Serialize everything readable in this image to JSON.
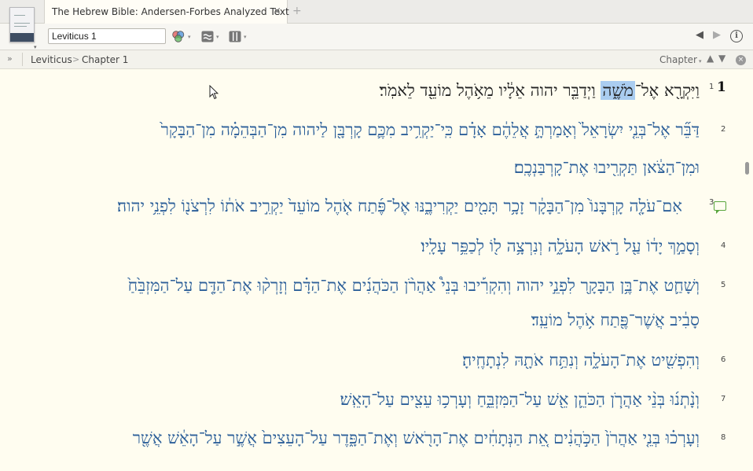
{
  "tab": {
    "title": "The Hebrew Bible: Andersen-Forbes Analyzed Text",
    "close_glyph": "×",
    "new_glyph": "+"
  },
  "thumbnail": {
    "caret": "▾"
  },
  "toolbar": {
    "reference_value": "Leviticus 1",
    "icons": [
      "visual-filters-icon",
      "parallel-resources-icon",
      "panel-layout-icon"
    ],
    "caret": "▾",
    "back_glyph": "◀",
    "forward_glyph": "▶",
    "info_glyph": "i"
  },
  "breadcrumb": {
    "expand_glyph": "»",
    "book": "Leviticus",
    "divider": ">",
    "chapter": "Chapter 1",
    "chapter_selector": "Chapter",
    "caret": "▾",
    "up_glyph": "▲",
    "down_glyph": "▼",
    "close_glyph": "×"
  },
  "colors": {
    "hebrew_text": "#2c5f99",
    "highlight": "#aacdf0",
    "note": "#59a63d",
    "background": "#fffdf0"
  },
  "text": {
    "chapter_number": "1",
    "verses": [
      {
        "num": "1",
        "parts": [
          "וַיִּקְרָ֖א אֶל־",
          "מֹשֶׁ֑ה",
          " וַיְדַבֵּ֤ר יהוה אֵלָ֔יו מֵאֹ֥הֶל מוֹעֵ֖ד לֵאמֹֽר׃"
        ]
      },
      {
        "num": "2",
        "lines": [
          "דַּבֵּ֞ר אֶל־בְּנֵ֤י יִשְׂרָאֵל֙ וְאָמַרְתָּ֣ אֲלֵהֶ֔ם אָדָ֗ם כִּֽי־יַקְרִ֥יב מִכֶּ֛ם קָרְבָּ֖ן לַיהוה מִן־הַבְּהֵמָ֗ה מִן־הַבָּקָר֙",
          "וּמִן־הַצֹּ֔אן תַּקְרִ֖יבוּ אֶת־קָרְבַּנְכֶֽם׃"
        ]
      },
      {
        "num": "3",
        "lines": [
          "אִם־עֹלָ֤ה קָרְבָּנוֹ֙ מִן־הַבָּקָ֔ר זָכָ֥ר תָּמִ֖ים יַקְרִיבֶ֑נּוּ אֶל־פֶּ֜תַח אֹ֤הֶל מוֹעֵד֙ יַקְרִ֣יב אֹת֔וֹ לִרְצֹנ֖וֹ לִפְנֵ֥י יהוה׃"
        ]
      },
      {
        "num": "4",
        "lines": [
          "וְסָמַ֣ךְ יָד֔וֹ עַ֖ל רֹ֣אשׁ הָעֹלָ֑ה וְנִרְצָ֥ה ל֖וֹ לְכַפֵּ֥ר עָלָֽיו׃"
        ]
      },
      {
        "num": "5",
        "lines": [
          "וְשָׁחַ֛ט אֶת־בֶּ֥ן הַבָּקָ֖ר לִפְנֵ֣י יהוה וְהִקְרִ֡יבוּ בְּנֵי֩ אַהֲרֹ֨ן הַכֹּהֲנִ֜ים אֶת־הַדָּ֗ם וְזָרְק֨וּ אֶת־הַדָּ֤ם עַל־הַמִּזְבֵּ֙חַ֙",
          "סָבִ֔יב אֲשֶׁר־פֶּ֖תַח אֹ֥הֶל מוֹעֵֽד׃"
        ]
      },
      {
        "num": "6",
        "lines": [
          "וְהִפְשִׁ֖יט אֶת־הָעֹלָ֑ה וְנִתַּ֥ח אֹתָ֖הּ לִנְתָחֶֽיהָ׃"
        ]
      },
      {
        "num": "7",
        "lines": [
          "וְנָ֨תְנ֜וּ בְּנֵ֨י אַהֲרֹ֧ן הַכֹּהֵ֛ן אֵ֖שׁ עַל־הַמִּזְבֵּ֑חַ וְעָרְכ֥וּ עֵצִ֖ים עַל־הָאֵֽשׁ׃"
        ]
      },
      {
        "num": "8",
        "lines": [
          "וְעָרְכ֗וּ בְּנֵ֤י אַהֲרֹן֙ הַכֹּ֣הֲנִ֔ים אֵ֚ת הַנְּתָחִ֔ים אֶת־הָרֹ֖אשׁ וְאֶת־הַפָּ֑דֶר עַל־הָעֵצִים֙ אֲשֶׁ֣ר עַל־הָאֵ֔שׁ אֲשֶׁ֖ר"
        ]
      }
    ]
  }
}
